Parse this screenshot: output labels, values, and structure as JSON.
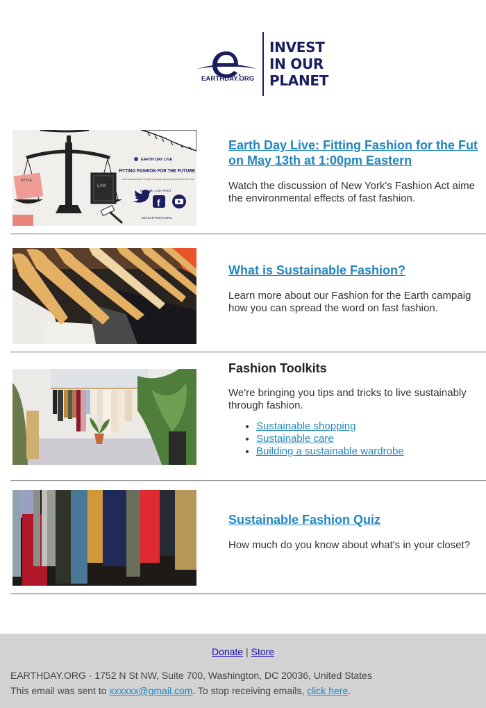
{
  "brand": {
    "org_name": "EARTHDAY.ORG",
    "slogan": [
      "INVEST",
      "IN OUR",
      "PLANET"
    ],
    "primary_color": "#1b1d5c",
    "link_color": "#2187c0"
  },
  "articles": [
    {
      "image_alt": "Earth Day Live: Fitting Fashion for the Future event graphic",
      "image_text": {
        "badge": "EARTH DAY LIVE",
        "headline": "FITTING FASHION FOR THE FUTURE",
        "subhead": "HOW THE FASHION ACT HOPES TO CHANGE THE FASHION INDUSTRY FOR GOOD",
        "date": "May 13th, 1:00 PM ET",
        "site": "and EARTHDAY.ORG",
        "book_label": "LAW",
        "magazine_label": "STYLE"
      },
      "title_lines": [
        "Earth Day Live: Fitting Fashion for the Fut",
        "on May 13th at 1:00pm Eastern"
      ],
      "title_is_link": true,
      "description_lines": [
        "Watch the discussion of New York's Fashion Act aime",
        "the environmental effects of fast fashion."
      ]
    },
    {
      "image_alt": "Clothes on wooden hangers",
      "title_lines": [
        "What is Sustainable Fashion?"
      ],
      "title_is_link": true,
      "description_lines": [
        "Learn more about our Fashion for the Earth campaig",
        "how you can spread the word on fast fashion."
      ]
    },
    {
      "image_alt": "Clothing rack in a bright room with plants",
      "title_lines": [
        "Fashion Toolkits"
      ],
      "title_is_link": false,
      "description_lines": [
        "We're bringing you tips and tricks to live sustainably",
        "through fashion."
      ],
      "links": [
        "Sustainable shopping",
        "Sustainable care",
        "Building a sustainable wardrobe"
      ]
    },
    {
      "image_alt": "Closeup of colorful jackets hanging in a closet",
      "title_lines": [
        "Sustainable Fashion Quiz"
      ],
      "title_is_link": true,
      "description_lines": [
        "How much do you know about what's in your closet?"
      ]
    }
  ],
  "footer": {
    "links": [
      "Donate",
      "Store"
    ],
    "separator": "|",
    "address": "EARTHDAY.ORG · 1752 N St NW, Suite 700, Washington, DC 20036, United States",
    "sent_prefix": "This email was sent to ",
    "email": "xxxxxx@gmail.com",
    "sent_middle": ". To stop receiving emails, ",
    "unsubscribe": "click here",
    "sent_suffix": "."
  }
}
